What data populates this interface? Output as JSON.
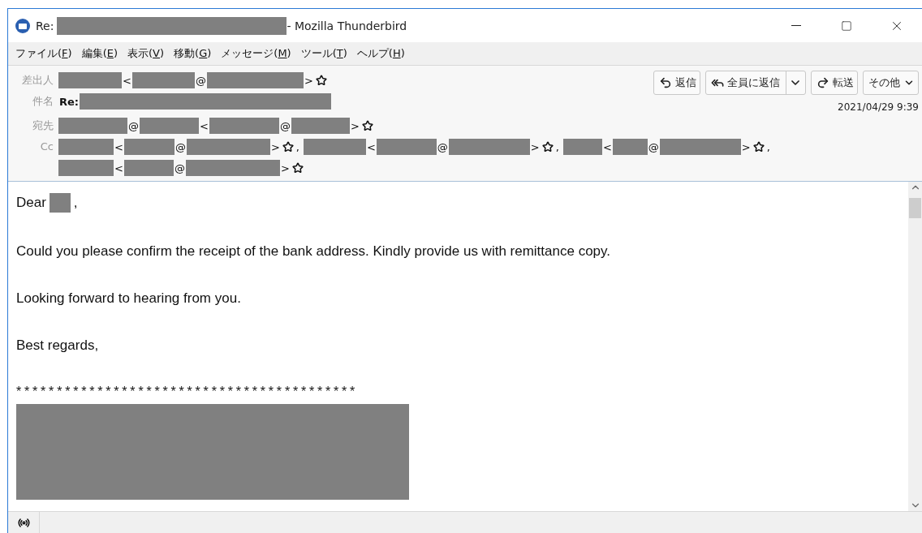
{
  "window": {
    "title_parts": [
      {
        "kind": "text",
        "text": "Re:"
      },
      {
        "kind": "redacted"
      },
      {
        "kind": "text",
        "text": "- Mozilla Thunderbird"
      }
    ]
  },
  "menu": [
    {
      "before": "ファイル(",
      "key": "F",
      "after": ")"
    },
    {
      "before": "編集(",
      "key": "E",
      "after": ")"
    },
    {
      "before": "表示(",
      "key": "V",
      "after": ")"
    },
    {
      "before": "移動(",
      "key": "G",
      "after": ")"
    },
    {
      "before": "メッセージ(",
      "key": "M",
      "after": ")"
    },
    {
      "before": "ツール(",
      "key": "T",
      "after": ")"
    },
    {
      "before": "ヘルプ(",
      "key": "H",
      "after": ")"
    }
  ],
  "actions": [
    {
      "kind": "reply",
      "label": "返信"
    },
    {
      "kind": "reply_all",
      "label": "全員に返信"
    },
    {
      "kind": "forward",
      "label": "転送"
    },
    {
      "kind": "more",
      "label": "その他"
    }
  ],
  "date": "2021/04/29 9:39",
  "fields": [
    {
      "label": "差出人",
      "entries": [
        [
          {
            "kind": "redacted"
          },
          {
            "kind": "text",
            "text": "<"
          },
          {
            "kind": "redacted"
          },
          {
            "kind": "text",
            "text": "@"
          },
          {
            "kind": "redacted"
          },
          {
            "kind": "text",
            "text": ">"
          },
          {
            "kind": "star"
          }
        ]
      ]
    },
    {
      "label": "件名",
      "entries": [
        [
          {
            "kind": "bold",
            "text": "Re:"
          },
          {
            "kind": "redacted"
          }
        ]
      ]
    },
    {
      "label": "宛先",
      "entries": [
        [
          {
            "kind": "redacted"
          },
          {
            "kind": "text",
            "text": "@"
          },
          {
            "kind": "redacted"
          },
          {
            "kind": "text",
            "text": "<"
          },
          {
            "kind": "redacted"
          },
          {
            "kind": "text",
            "text": "@"
          },
          {
            "kind": "redacted"
          },
          {
            "kind": "text",
            "text": ">"
          },
          {
            "kind": "star"
          }
        ]
      ]
    },
    {
      "label": "Cc",
      "entries": [
        [
          {
            "kind": "redacted"
          },
          {
            "kind": "text",
            "text": "<"
          },
          {
            "kind": "redacted"
          },
          {
            "kind": "text",
            "text": "@"
          },
          {
            "kind": "redacted"
          },
          {
            "kind": "text",
            "text": ">"
          },
          {
            "kind": "star"
          },
          {
            "kind": "text",
            "text": ","
          }
        ],
        [
          {
            "kind": "redacted"
          },
          {
            "kind": "text",
            "text": "<"
          },
          {
            "kind": "redacted"
          },
          {
            "kind": "text",
            "text": "@"
          },
          {
            "kind": "redacted"
          },
          {
            "kind": "text",
            "text": ">"
          },
          {
            "kind": "star"
          },
          {
            "kind": "text",
            "text": ","
          }
        ],
        [
          {
            "kind": "redacted"
          },
          {
            "kind": "text",
            "text": "<"
          },
          {
            "kind": "redacted"
          },
          {
            "kind": "text",
            "text": "@"
          },
          {
            "kind": "redacted"
          },
          {
            "kind": "text",
            "text": ">"
          },
          {
            "kind": "star"
          },
          {
            "kind": "text",
            "text": ","
          }
        ],
        [
          {
            "kind": "redacted"
          },
          {
            "kind": "text",
            "text": "<"
          },
          {
            "kind": "redacted"
          },
          {
            "kind": "text",
            "text": "@"
          },
          {
            "kind": "redacted"
          },
          {
            "kind": "text",
            "text": ">"
          },
          {
            "kind": "star"
          }
        ]
      ]
    }
  ],
  "body": [
    {
      "kind": "greeting",
      "parts": [
        {
          "kind": "text",
          "text": "Dear"
        },
        {
          "kind": "redacted"
        },
        {
          "kind": "text",
          "text": ","
        }
      ]
    },
    {
      "kind": "para",
      "text": "Could you please confirm the receipt of the bank address. Kindly provide us with remittance copy."
    },
    {
      "kind": "para",
      "text": "Looking forward to hearing from you."
    },
    {
      "kind": "para",
      "text": "Best regards,"
    },
    {
      "kind": "rule",
      "text": "******************************************"
    },
    {
      "kind": "signature_redacted"
    }
  ]
}
